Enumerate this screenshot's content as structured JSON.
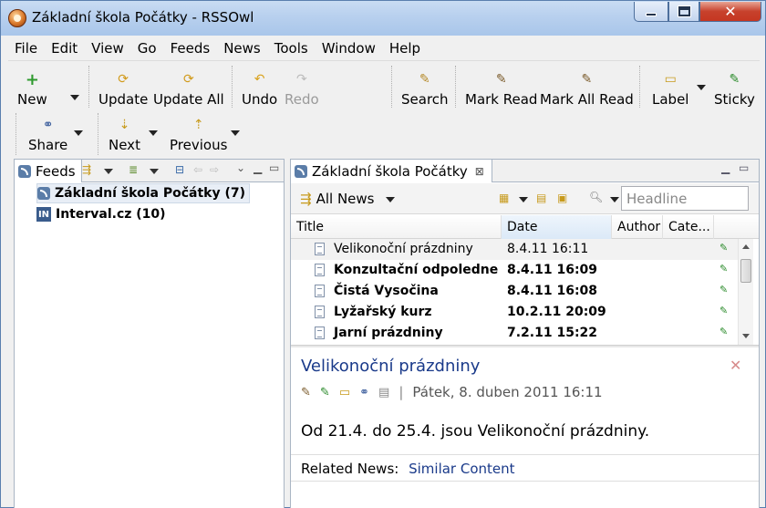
{
  "window": {
    "title": "Základní škola Počátky - RSSOwl"
  },
  "menu": [
    "File",
    "Edit",
    "View",
    "Go",
    "Feeds",
    "News",
    "Tools",
    "Window",
    "Help"
  ],
  "toolbar": {
    "new": "New",
    "update": "Update",
    "update_all": "Update All",
    "undo": "Undo",
    "redo": "Redo",
    "search": "Search",
    "mark_read": "Mark Read",
    "mark_all_read": "Mark All Read",
    "label": "Label",
    "sticky": "Sticky",
    "share": "Share",
    "next": "Next",
    "previous": "Previous"
  },
  "left_pane": {
    "tab": "Feeds",
    "items": [
      {
        "label": "Základní škola Počátky (7)",
        "icon": "rss-icon"
      },
      {
        "label": "Interval.cz (10)",
        "icon": "interval-icon",
        "icon_text": "IN"
      }
    ]
  },
  "right_pane": {
    "tab": "Základní škola Počátky",
    "filter": "All News",
    "search_placeholder": "Headline",
    "columns": [
      "Title",
      "Date",
      "Author",
      "Cate..."
    ],
    "rows": [
      {
        "title": "Velikonoční prázdniny",
        "date": "8.4.11 16:11",
        "unread": false
      },
      {
        "title": "Konzultační odpoledne",
        "date": "8.4.11 16:09",
        "unread": true
      },
      {
        "title": "Čistá Vysočina",
        "date": "8.4.11 16:08",
        "unread": true
      },
      {
        "title": "Lyžařský kurz",
        "date": "10.2.11 20:09",
        "unread": true
      },
      {
        "title": "Jarní prázdniny",
        "date": "7.2.11 15:22",
        "unread": true
      }
    ]
  },
  "preview": {
    "title": "Velikonoční prázdniny",
    "separator": "|",
    "date": "Pátek, 8. duben 2011 16:11",
    "body": "Od 21.4. do 25.4. jsou Velikonoční prázdniny.",
    "related_label": "Related News:",
    "related_link": "Similar Content"
  }
}
